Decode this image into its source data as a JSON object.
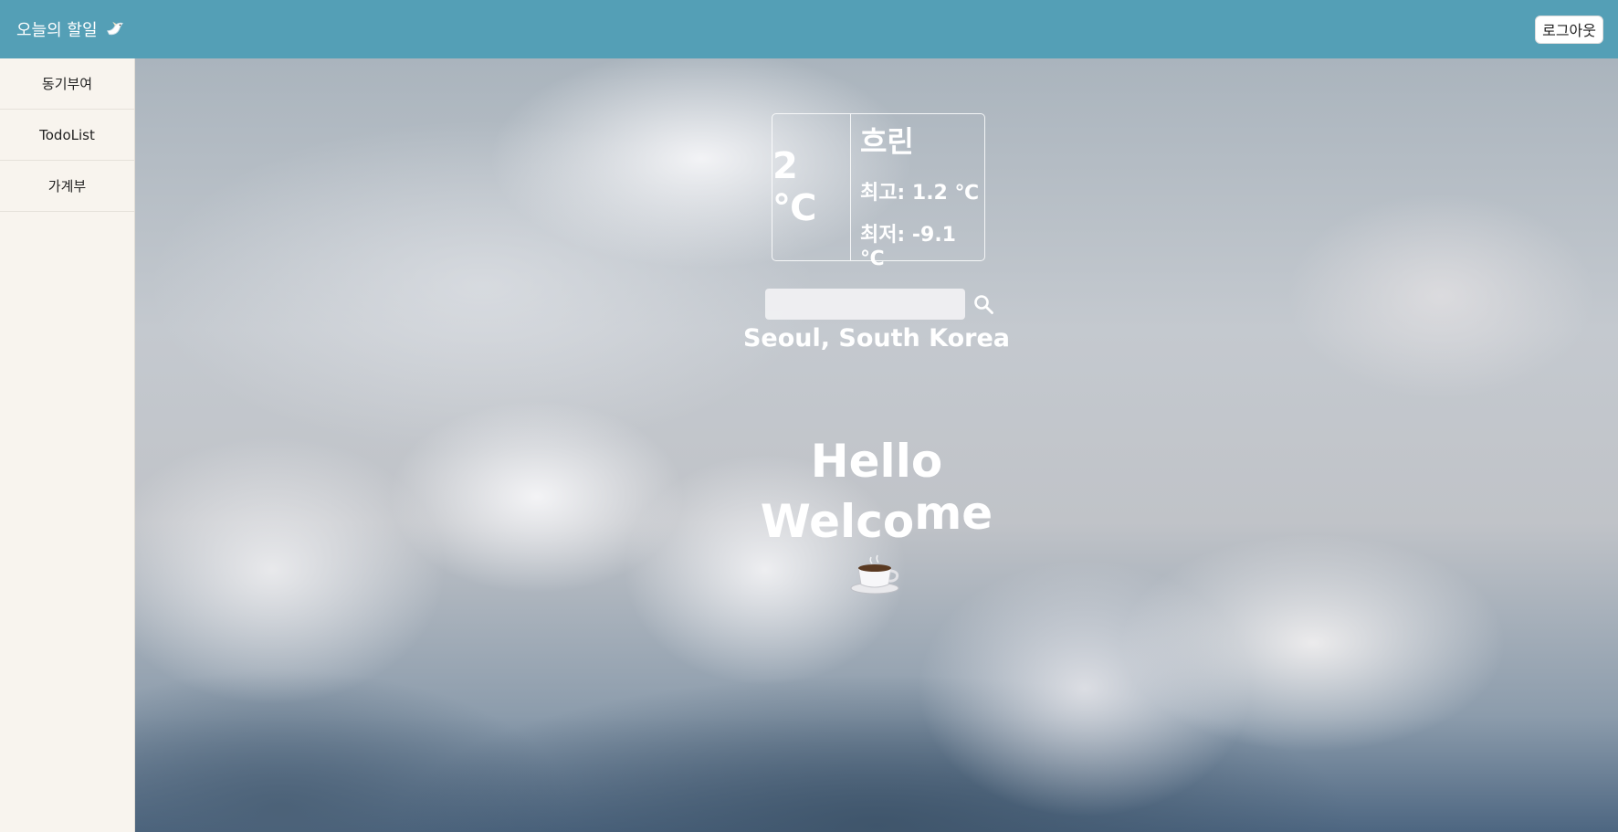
{
  "header": {
    "title": "오늘의 할일",
    "brand_icon": "dove-icon",
    "logout_label": "로그아웃",
    "bg_color": "#549fb6"
  },
  "sidebar": {
    "items": [
      {
        "label": "동기부여"
      },
      {
        "label": "TodoList"
      },
      {
        "label": "가계부"
      }
    ]
  },
  "weather": {
    "temp": "2 ℃",
    "description": "흐린",
    "max": "최고: 1.2 ℃",
    "min": "최저: -9.1 ℃",
    "location": "Seoul, South Korea"
  },
  "search": {
    "value": "",
    "icon": "search-icon"
  },
  "greeting": {
    "line1": "Hello",
    "line2_part1": "Welco",
    "line2_part2": "me",
    "icon": "coffee-cup-icon"
  }
}
